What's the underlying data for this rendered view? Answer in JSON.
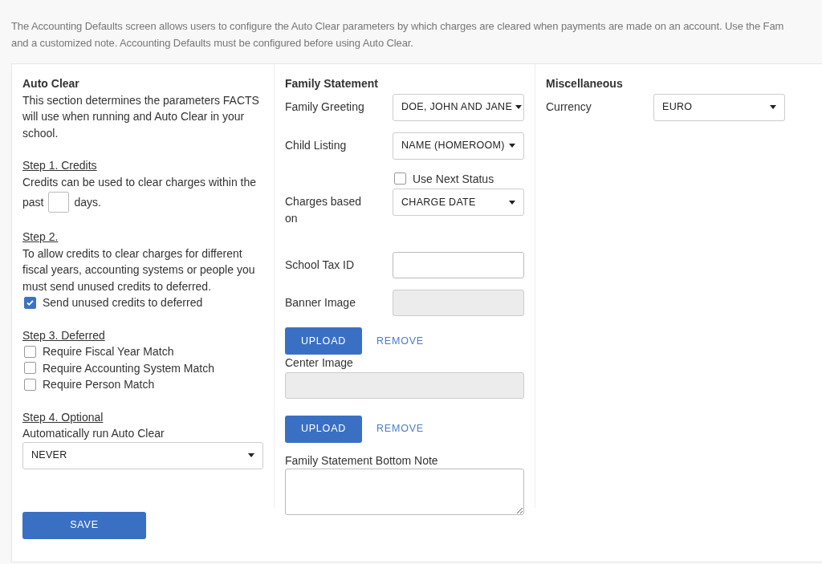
{
  "intro": [
    "The Accounting Defaults screen allows users to configure the Auto Clear parameters by which charges are cleared when payments are made on an account. Use the Fam",
    "and a customized note. Accounting Defaults must be configured before using Auto Clear."
  ],
  "auto_clear": {
    "title": "Auto Clear",
    "description": "This section determines the parameters FACTS will use when running and Auto Clear in your school.",
    "step1": {
      "heading": "Step 1. Credits",
      "text_before": "Credits can be used to clear charges within the",
      "text_past": "past",
      "text_after": "days."
    },
    "step2": {
      "heading": "Step 2.",
      "text": "To allow credits to clear charges for different fiscal years, accounting systems or people you must send unused credits to deferred.",
      "checkbox": {
        "label": "Send unused credits to deferred",
        "checked": true
      }
    },
    "step3": {
      "heading": "Step 3. Deferred",
      "checkboxes": [
        {
          "label": "Require Fiscal Year Match",
          "checked": false
        },
        {
          "label": "Require Accounting System Match",
          "checked": false
        },
        {
          "label": "Require Person Match",
          "checked": false
        }
      ]
    },
    "step4": {
      "heading": "Step 4. Optional",
      "label": "Automatically run Auto Clear",
      "value": "NEVER"
    }
  },
  "save_button": "SAVE",
  "family_statement": {
    "title": "Family Statement",
    "fields": [
      {
        "kind": "select",
        "label": "Family Greeting",
        "value": "DOE, JOHN AND JANE"
      },
      {
        "kind": "select",
        "label": "Child Listing",
        "value": "NAME (HOMEROOM)"
      },
      {
        "kind": "checkbox",
        "label": "Use Next Status",
        "checked": false
      },
      {
        "kind": "select",
        "label": "Charges based on",
        "value": "CHARGE DATE"
      },
      {
        "kind": "text",
        "label": "School Tax ID"
      },
      {
        "kind": "image",
        "label": "Banner Image",
        "upload": "UPLOAD",
        "remove": "REMOVE"
      },
      {
        "kind": "image_stacked",
        "label": "Center Image",
        "upload": "UPLOAD",
        "remove": "REMOVE"
      },
      {
        "kind": "textarea",
        "label": "Family Statement Bottom Note"
      }
    ]
  },
  "miscellaneous": {
    "title": "Miscellaneous",
    "fields": [
      {
        "kind": "select",
        "label": "Currency",
        "value": "EURO"
      }
    ]
  }
}
